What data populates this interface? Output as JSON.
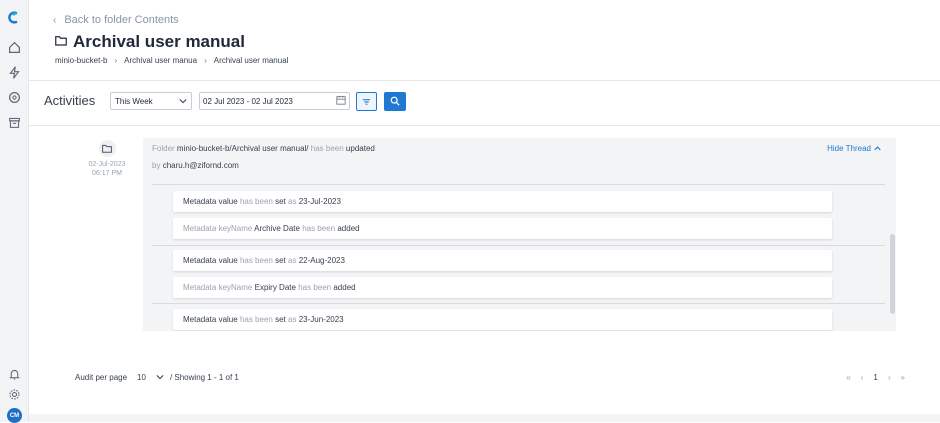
{
  "app": {
    "colors": {
      "accent": "#1f78d1",
      "sidebar_bg": "#f1f3f5",
      "avatar_bg": "#1f6fc5"
    },
    "avatar_initials": "CM"
  },
  "sidebar": {
    "icons": [
      "logo-icon",
      "home-icon",
      "lightning-icon",
      "aperture-icon",
      "archive-icon",
      "bell-icon",
      "gear-icon"
    ]
  },
  "header": {
    "back_label": "Back to folder Contents",
    "title": "Archival user manual",
    "breadcrumb": [
      "minio-bucket-b",
      "Archival user manua",
      "Archival user manual"
    ]
  },
  "filters": {
    "label": "Activities",
    "period_value": "This Week",
    "date_range_value": "02 Jul 2023 - 02 Jul 2023"
  },
  "activity": {
    "date": "02-Jul-2023",
    "time": "06:17 PM",
    "head_prefix": "Folder",
    "head_path": "minio-bucket-b/Archival user manual/",
    "head_has_been": "has been",
    "head_action": "updated",
    "by_prefix": "by",
    "by_user": "charu.h@zifornd.com",
    "hide_thread_label": "Hide Thread",
    "rows": [
      {
        "a": "Metadata value",
        "b": "has been",
        "c": "set",
        "d": "as",
        "e": "23-Jul-2023"
      },
      {
        "a": "Metadata keyName",
        "b": "Archive Date",
        "c": "has been",
        "d": "added"
      },
      {
        "a": "Metadata value",
        "b": "has been",
        "c": "set",
        "d": "as",
        "e": "22-Aug-2023"
      },
      {
        "a": "Metadata keyName",
        "b": "Expiry Date",
        "c": "has been",
        "d": "added"
      },
      {
        "a": "Metadata value",
        "b": "has been",
        "c": "set",
        "d": "as",
        "e": "23-Jun-2023"
      }
    ]
  },
  "footer": {
    "per_page_label": "Audit per page",
    "per_page_value": "10",
    "showing_text": "/ Showing 1 - 1 of 1",
    "current_page": "1",
    "first_symbol": "«",
    "prev_symbol": "‹",
    "next_symbol": "›",
    "last_symbol": "»"
  }
}
